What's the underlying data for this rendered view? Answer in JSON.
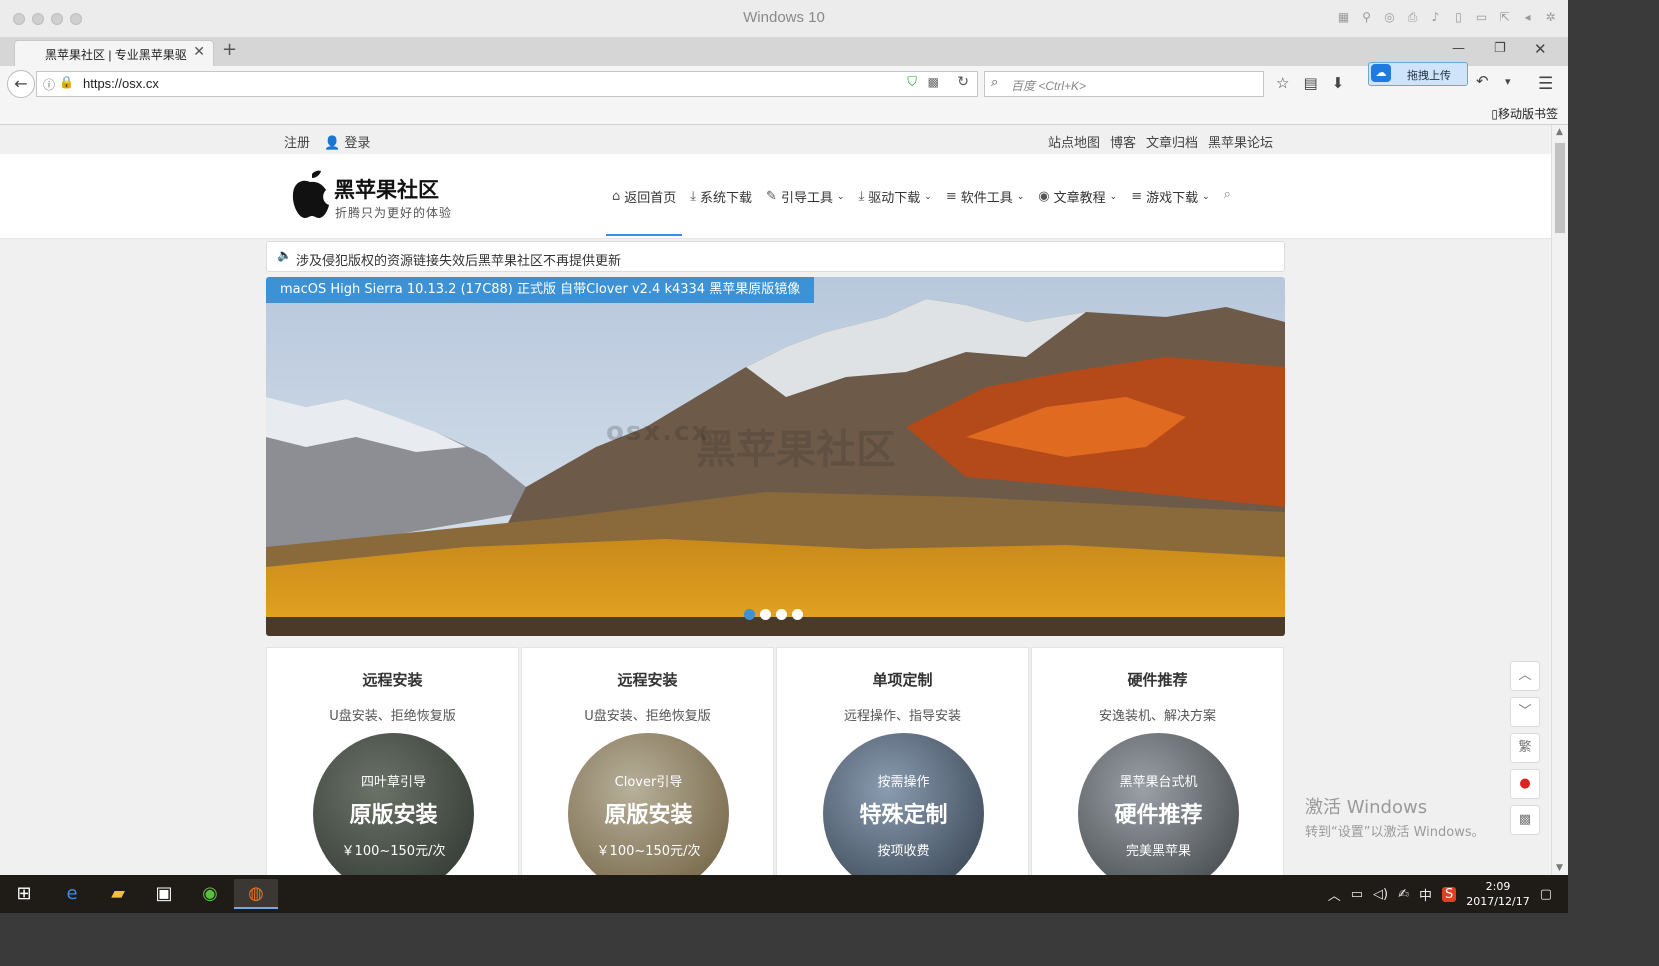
{
  "vm": {
    "title": "Windows 10"
  },
  "browser": {
    "tab_title": "黑苹果社区 | 专业黑苹果驱",
    "url": "https://osx.cx",
    "search_placeholder": "百度 <Ctrl+K>",
    "upload_label": "拖拽上传",
    "mobile_bookmarks": "移动版书签"
  },
  "site": {
    "top_left": {
      "register": "注册",
      "login": "登录"
    },
    "top_right": [
      "站点地图",
      "博客",
      "文章归档",
      "黑苹果论坛"
    ],
    "logo_name": "黑苹果社区",
    "logo_tagline": "折腾只为更好的体验",
    "nav": [
      {
        "label": "返回首页",
        "icon": "home-icon",
        "glyph": "⌂"
      },
      {
        "label": "系统下载",
        "icon": "download-icon",
        "glyph": "⤓"
      },
      {
        "label": "引导工具",
        "icon": "pencil-icon",
        "glyph": "✎"
      },
      {
        "label": "驱动下载",
        "icon": "download-icon",
        "glyph": "⤓"
      },
      {
        "label": "软件工具",
        "icon": "list-icon",
        "glyph": "≡"
      },
      {
        "label": "文章教程",
        "icon": "eye-icon",
        "glyph": "◉"
      },
      {
        "label": "游戏下载",
        "icon": "list-icon",
        "glyph": "≡"
      }
    ],
    "notice": "涉及侵犯版权的资源链接失效后黑苹果社区不再提供更新",
    "banner": {
      "caption": "macOS High Sierra 10.13.2 (17C88) 正式版 自带Clover v2.4 k4334 黑苹果原版镜像",
      "watermark_small": "osx.cx",
      "watermark_big": "黑苹果社区",
      "active_slide": 1,
      "slide_count": 4
    },
    "cards": [
      {
        "title": "远程安装",
        "subtitle": "U盘安装、拒绝恢复版",
        "top": "四叶草引导",
        "main": "原版安装",
        "bottom": "￥100~150元/次",
        "bg": "#3a4640"
      },
      {
        "title": "远程安装",
        "subtitle": "U盘安装、拒绝恢复版",
        "top": "Clover引导",
        "main": "原版安装",
        "bottom": "￥100~150元/次",
        "bg": "#8a7a60"
      },
      {
        "title": "单项定制",
        "subtitle": "远程操作、指导安装",
        "top": "按需操作",
        "main": "特殊定制",
        "bottom": "按项收费",
        "bg": "#4a5a6a"
      },
      {
        "title": "硬件推荐",
        "subtitle": "安逸装机、解决方案",
        "top": "黑苹果台式机",
        "main": "硬件推荐",
        "bottom": "完美黑苹果",
        "bg": "#5a5e62"
      }
    ],
    "side_buttons": {
      "up": "︿",
      "down": "﹀",
      "traditional": "繁"
    }
  },
  "activation": {
    "line1": "激活 Windows",
    "line2": "转到“设置”以激活 Windows。"
  },
  "taskbar": {
    "ime": "中",
    "time": "2:09",
    "date": "2017/12/17"
  }
}
